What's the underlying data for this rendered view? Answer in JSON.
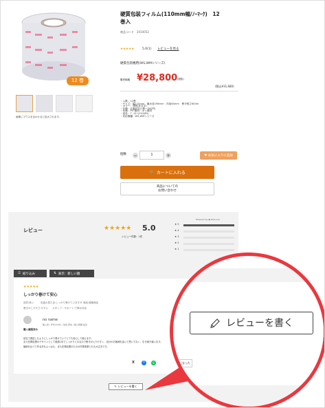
{
  "product": {
    "title_line1": "硬質包装フィルム(110mm幅/ﾉｰﾏｰｸ)　12",
    "title_line2": "巻入",
    "code_label": "商品コード　2010052",
    "rating": "★★★★★",
    "rating_score": "5.0(1)",
    "review_link": "レビューを見る",
    "series": "硬質包装機用(WS,WMシリーズ)",
    "price_label": "販売価格",
    "price": "¥28,800",
    "tax_note": "(税抜)",
    "tax_incl": "(税込¥31,680)",
    "badge": "12 巻",
    "image_caption": "画像にマウスを合わせると拡大されます。",
    "specs": [
      "・入数：12巻",
      "・サイズ：幅110mm　最大径198mm　内径64mm　巻き長さ600m",
      "・カラー：透明(非文字)",
      "・仕様：片面印字(1巻一500円)",
      "・仕様：PET素材・ポリ素材",
      "・品名：ﾃﾞｰﾄﾛｰﾙ110(80)",
      "・対応機種：WS,WMシリーズ"
    ],
    "qty_label": "個数",
    "qty_value": "1",
    "minus": "−",
    "plus": "+",
    "fav_label": "♥ お気に入りに追加",
    "cart_label": "カートに入れる",
    "ask_line1": "商品についての",
    "ask_line2": "お問い合わせ"
  },
  "reviews": {
    "heading": "レビュー",
    "stars": "★★★★★",
    "score": "5.0",
    "count": "レビュー件数：1件",
    "brand": "Powered by ◆ ZenLoop",
    "dist_labels": [
      "★ 5",
      "★ 4",
      "★ 3",
      "★ 2",
      "★ 1"
    ],
    "dist": [
      1,
      0,
      0,
      0,
      0
    ],
    "filter_label": "絞り込み",
    "sort_label": "表示：新しい順",
    "card": {
      "stars": "★★★★★",
      "title": "しっかり巻けて安心",
      "tags": [
        "品質:良い",
        "包装の見た目:しっかり巻けていますか",
        "商品:価格満足",
        "巻きのしやすさ:やすい",
        "スタッフ・サポート:丁寧な対応"
      ],
      "user": "no name",
      "user_meta": "購入者 / 年代(50代) / 性別:男性 / 購入時期:最近",
      "verified": "購入確認済み",
      "body1": "該当で発送したようにしっかり巻けていてとても安心して使えます。",
      "body2": "また在庫処理のデザインとして実施1本でしっかりとなるので巻きが入りやすく、自分のお客様を遠いで思いでなく、引き続き使います。",
      "body3": "継続を比べて作る手をよく似た、また在庫処理のものの作業事業とれも大丈夫です。",
      "helpful": "参考になった",
      "share": [
        "X",
        "f",
        "©"
      ]
    },
    "write_label": "レビューを書く",
    "write_label_zoom": "レビューを書く"
  },
  "colors": {
    "price_red": "#e32a1f",
    "cart_orange": "#d9700d",
    "star": "#f2a515",
    "callout_red": "#e9383e"
  }
}
